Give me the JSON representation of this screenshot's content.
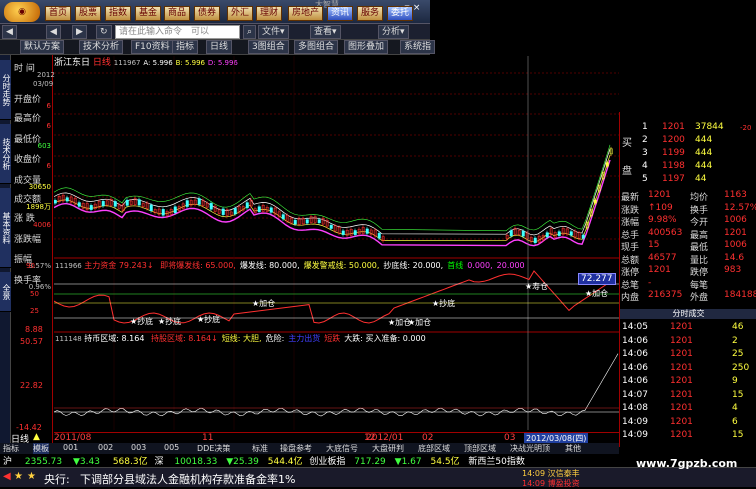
{
  "topbar": {
    "nav_buttons": [
      "首页",
      "股票",
      "指数",
      "基金",
      "商品",
      "债券",
      "外汇",
      "理财",
      "房地产",
      "资讯",
      "服务",
      "委托"
    ],
    "window_title": "大智慧",
    "win_controls": "— ▫ ×"
  },
  "toolbar": {
    "cmd_placeholder": "请在此输入命令",
    "cmd_suffix": "可以",
    "menus": [
      "文件▾",
      "查看▾",
      "分析▾"
    ]
  },
  "toolbar2": {
    "buttons": [
      "默认方案",
      "技术分析",
      "F10资料",
      "指标",
      "日线",
      "3图组合",
      "多图组合",
      "图形叠加",
      "系统指"
    ]
  },
  "chart_header": {
    "stock": "浙江东日",
    "period": "日线",
    "code": "111967",
    "a_label": "A: 5.996",
    "b_label": "B: 5.996",
    "d_label": "D: 5.996"
  },
  "info_labels": {
    "time": "时 间",
    "time_vals": [
      "2012",
      "03/09"
    ],
    "open": "开盘价",
    "high": "最高价",
    "low": "最低价",
    "close": "收盘价",
    "volume": "成交量",
    "amount": "成交额",
    "change": "涨 跌",
    "change_pct": "涨跌幅",
    "amplitude": "振幅",
    "turnover": "换手率",
    "vol_val": "30650",
    "amt_val": "1898万",
    "open_val": "6",
    "high_val": "6",
    "low_val": "603",
    "close_val": "6",
    "chg_val": "4006",
    "amp_val": "3.57%",
    "turn_val": "0.96%"
  },
  "sidebar_tabs": [
    "分时走势",
    "技术分析",
    "基本资料",
    "全景"
  ],
  "indicator1": {
    "code": "111966",
    "name": "主力资金",
    "value": "79.243↓",
    "items": [
      {
        "label": "即将爆发线: 65.000,",
        "color": "#ff3030"
      },
      {
        "label": "爆发线: 80.000,",
        "color": "#ffffff"
      },
      {
        "label": "爆发警戒线: 50.000,",
        "color": "#ffff40"
      },
      {
        "label": "抄底线: 20.000,",
        "color": "#ffffff"
      },
      {
        "label": "首线",
        "color": "#00ff00"
      },
      {
        "label": "0.000,",
        "color": "#ff40ff"
      },
      {
        "label": "20.000",
        "color": "#ff40ff"
      }
    ],
    "badge": "72.277",
    "axis": [
      "90",
      "50",
      "25",
      "8.88"
    ],
    "signals": [
      "抄底",
      "抄底",
      "抄底",
      "加仓",
      "加仓",
      "加仓",
      "抄底",
      "加仓",
      "寿仓"
    ]
  },
  "indicator2": {
    "code": "111148",
    "name": "持币区域: 8.164",
    "items": [
      {
        "label": "持股区域: 8.164↓",
        "color": "#ff3030"
      },
      {
        "label": "短线: 大胆,",
        "color": "#ffff40"
      },
      {
        "label": "危险:",
        "color": "#ffffff"
      },
      {
        "label": "主力出货",
        "color": "#4040ff"
      },
      {
        "label": "短跌",
        "color": "#ff3030"
      },
      {
        "label": "大跌: 买入准备: 0.000",
        "color": "#ffffff"
      }
    ],
    "axis": [
      "50.57",
      "22.82",
      "-14.42"
    ]
  },
  "right_panel": {
    "sell_label": "买",
    "buy_label": "盘",
    "order_rows": [
      {
        "n": "1",
        "p": "1201",
        "v": "37844"
      },
      {
        "n": "2",
        "p": "1200",
        "v": "444"
      },
      {
        "n": "3",
        "p": "1199",
        "v": "444"
      },
      {
        "n": "4",
        "p": "1198",
        "v": "444"
      },
      {
        "n": "5",
        "p": "1197",
        "v": "44"
      }
    ],
    "stats": [
      {
        "l": "最新",
        "v1": "1201",
        "m": "均价",
        "v2": "1163"
      },
      {
        "l": "涨跌",
        "v1": "↑109",
        "m": "换手",
        "v2": "12.57%"
      },
      {
        "l": "涨幅",
        "v1": "9.98%",
        "m": "今开",
        "v2": "1006"
      },
      {
        "l": "总手",
        "v1": "400563",
        "m": "最高",
        "v2": "1201"
      },
      {
        "l": "现手",
        "v1": "15",
        "m": "最低",
        "v2": "1006"
      },
      {
        "l": "总额",
        "v1": "46577",
        "m": "量比",
        "v2": "14.6"
      },
      {
        "l": "涨停",
        "v1": "1201",
        "m": "跌停",
        "v2": "983"
      },
      {
        "l": "总笔",
        "v1": "-",
        "m": "每笔",
        "v2": ""
      },
      {
        "l": "内盘",
        "v1": "216375",
        "m": "外盘",
        "v2": "184188"
      }
    ],
    "ticks_title": "分时成交",
    "ticks": [
      {
        "t": "14:05",
        "p": "1201",
        "v": "46"
      },
      {
        "t": "14:06",
        "p": "1201",
        "v": "2"
      },
      {
        "t": "14:06",
        "p": "1201",
        "v": "25"
      },
      {
        "t": "14:06",
        "p": "1201",
        "v": "250"
      },
      {
        "t": "14:06",
        "p": "1201",
        "v": "9"
      },
      {
        "t": "14:07",
        "p": "1201",
        "v": "15"
      },
      {
        "t": "14:08",
        "p": "1201",
        "v": "4"
      },
      {
        "t": "14:09",
        "p": "1201",
        "v": "6"
      },
      {
        "t": "14:09",
        "p": "1201",
        "v": "15"
      }
    ],
    "top_val": "-20"
  },
  "time_axis": {
    "ticks": [
      "2011/08",
      "",
      "11",
      "",
      "12",
      "2012/01",
      "02",
      "03"
    ],
    "current": "2012/03/08(四)",
    "period_label": "日线"
  },
  "menu_row": {
    "items": [
      "指标",
      "模板",
      "001",
      "002",
      "003",
      "005",
      "DDE决策",
      "标准",
      "操盘参考",
      "大底信号",
      "大盘研判",
      "底部区域",
      "顶部区域",
      "决战光明顶",
      "其他"
    ]
  },
  "status_row": {
    "sh_label": "沪",
    "sh_val": "2355.73",
    "sh_chg": "▼3.43",
    "sh_amt": "568.3亿",
    "sz_label": "深",
    "sz_val": "10018.33",
    "sz_chg": "▼25.39",
    "sz_amt": "544.4亿",
    "gem_label": "创业板指",
    "gem_val": "717.29",
    "gem_chg": "▼1.67",
    "gem_amt": "54.5亿",
    "xinxi": "新西兰50指数"
  },
  "news_row": {
    "prefix": "央行:",
    "text": "下调部分县域法人金融机构存款准备金率1%",
    "alert1": "14:09 汉信泰丰",
    "alert2": "14:09 博盈投资"
  },
  "watermark": "www.7gpzb.com",
  "colors": {
    "red": "#ff3030",
    "yellow": "#ffff40",
    "cyan": "#40ffff",
    "green": "#00ff00",
    "magenta": "#ff40ff",
    "grid": "#a00000"
  },
  "chart_data": {
    "type": "line",
    "title": "",
    "series": [],
    "note_ma": "",
    "candles_recent": [
      6.0,
      6.1,
      6.2,
      6.3,
      6.5,
      6.7,
      6.9,
      7.1,
      7.3,
      7.6,
      7.9,
      8.3,
      8.7,
      9.2,
      9.8,
      10.5,
      11.2,
      12.01
    ],
    "ylim": [
      5,
      13
    ]
  }
}
